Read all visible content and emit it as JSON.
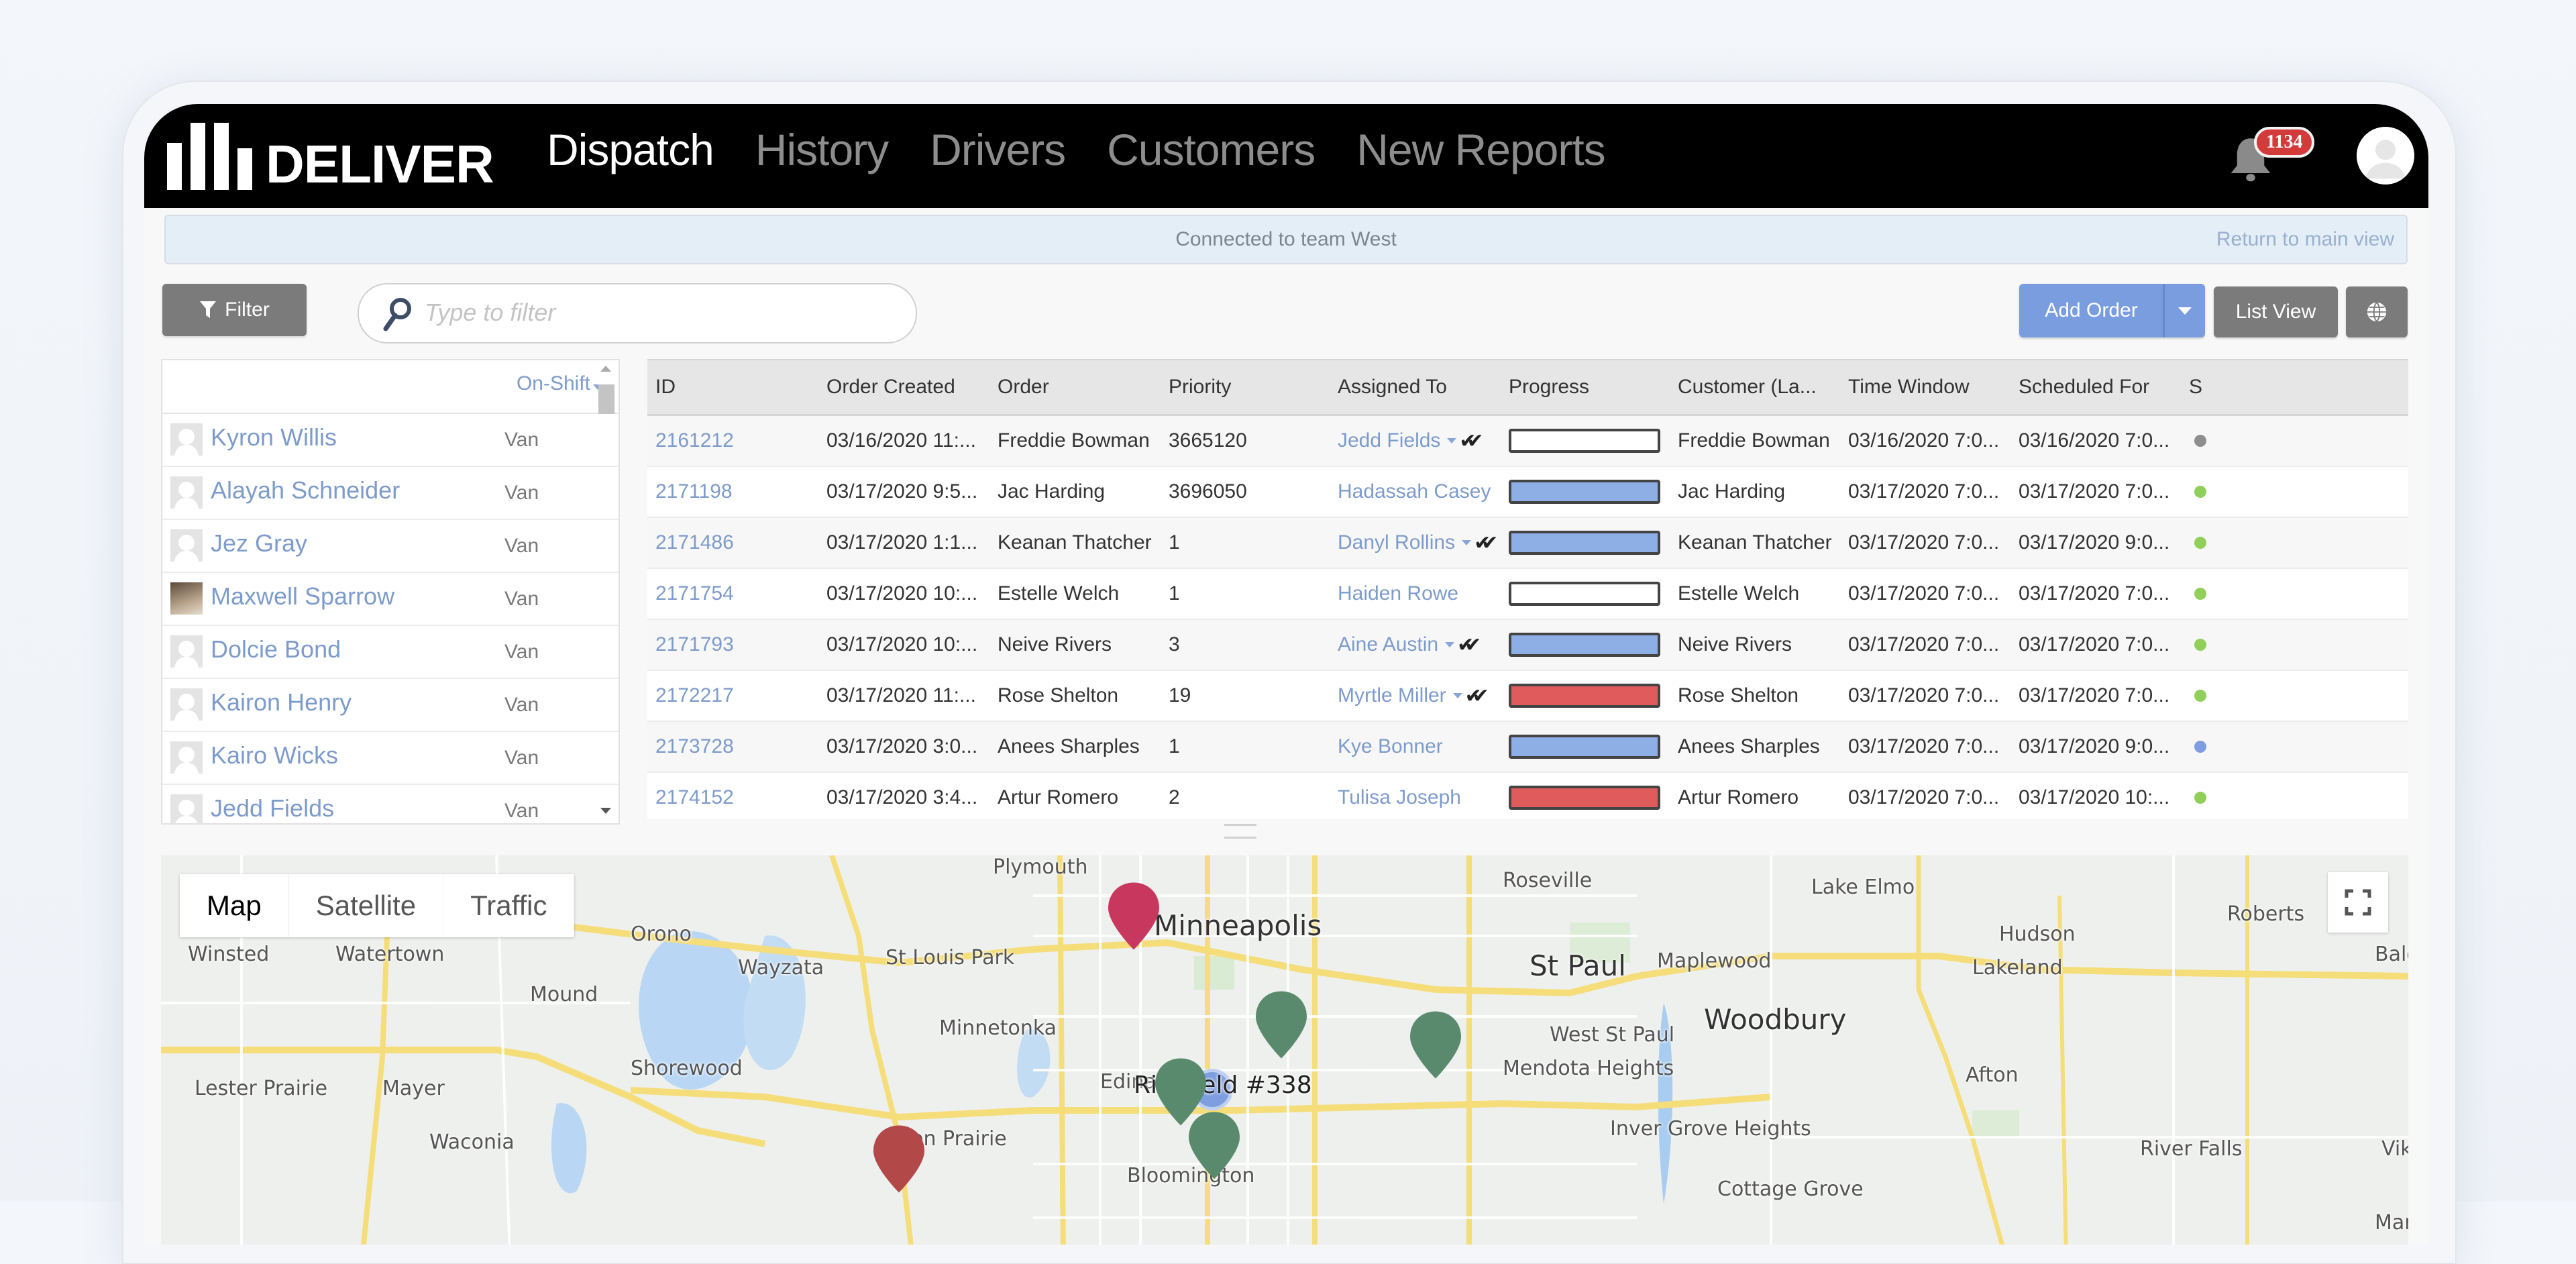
{
  "header": {
    "brand": "DELIVER",
    "nav": [
      {
        "label": "Dispatch",
        "active": true
      },
      {
        "label": "History",
        "active": false
      },
      {
        "label": "Drivers",
        "active": false
      },
      {
        "label": "Customers",
        "active": false
      },
      {
        "label": "New Reports",
        "active": false
      }
    ],
    "notification_count": "1134",
    "icons": {
      "bell": "bell-icon",
      "avatar": "user-avatar-icon"
    }
  },
  "notice": {
    "message": "Connected to team West",
    "return_link": "Return to main view"
  },
  "toolbar": {
    "filter_label": "Filter",
    "search_placeholder": "Type to filter",
    "search_value": "",
    "add_order_label": "Add Order",
    "list_view_label": "List View",
    "icons": {
      "filter": "funnel-icon",
      "search": "search-icon",
      "add_order_menu": "caret-down-icon",
      "map_view": "globe-icon"
    }
  },
  "drivers": {
    "filter_label": "On-Shift",
    "items": [
      {
        "name": "Kyron Willis",
        "vehicle": "Van",
        "has_photo": false
      },
      {
        "name": "Alayah Schneider",
        "vehicle": "Van",
        "has_photo": false
      },
      {
        "name": "Jez Gray",
        "vehicle": "Van",
        "has_photo": false
      },
      {
        "name": "Maxwell Sparrow",
        "vehicle": "Van",
        "has_photo": true
      },
      {
        "name": "Dolcie Bond",
        "vehicle": "Van",
        "has_photo": false
      },
      {
        "name": "Kairon Henry",
        "vehicle": "Van",
        "has_photo": false
      },
      {
        "name": "Kairo Wicks",
        "vehicle": "Van",
        "has_photo": false
      },
      {
        "name": "Jedd Fields",
        "vehicle": "Van",
        "has_photo": false
      }
    ]
  },
  "orders": {
    "columns": [
      "ID",
      "Order Created",
      "Order",
      "Priority",
      "Assigned To",
      "Progress",
      "Customer (La...",
      "Time Window",
      "Scheduled For",
      "S"
    ],
    "rows": [
      {
        "id": "2161212",
        "created": "03/16/2020 11:...",
        "order": "Freddie Bowman",
        "priority": "3665120",
        "assigned": "Jedd Fields",
        "assign_menu": true,
        "confirmed": true,
        "progress": "not-started",
        "progress_color": "#ffffff",
        "customer": "Freddie Bowman",
        "time_window": "03/16/2020 7:0...",
        "scheduled": "03/16/2020 7:0...",
        "status_color": "#8e8e8e"
      },
      {
        "id": "2171198",
        "created": "03/17/2020 9:5...",
        "order": "Jac Harding",
        "priority": "3696050",
        "assigned": "Hadassah Casey",
        "assign_menu": false,
        "confirmed": false,
        "progress": "in-progress",
        "progress_color": "#8eaee6",
        "customer": "Jac Harding",
        "time_window": "03/17/2020 7:0...",
        "scheduled": "03/17/2020 7:0...",
        "status_color": "#8fcf5a"
      },
      {
        "id": "2171486",
        "created": "03/17/2020 1:1...",
        "order": "Keanan Thatcher",
        "priority": "1",
        "assigned": "Danyl Rollins",
        "assign_menu": true,
        "confirmed": true,
        "progress": "in-progress",
        "progress_color": "#8eaee6",
        "customer": "Keanan Thatcher",
        "time_window": "03/17/2020 7:0...",
        "scheduled": "03/17/2020 9:0...",
        "status_color": "#8fcf5a"
      },
      {
        "id": "2171754",
        "created": "03/17/2020 10:...",
        "order": "Estelle Welch",
        "priority": "1",
        "assigned": "Haiden Rowe",
        "assign_menu": false,
        "confirmed": false,
        "progress": "not-started",
        "progress_color": "#ffffff",
        "customer": "Estelle Welch",
        "time_window": "03/17/2020 7:0...",
        "scheduled": "03/17/2020 7:0...",
        "status_color": "#8fcf5a"
      },
      {
        "id": "2171793",
        "created": "03/17/2020 10:...",
        "order": "Neive Rivers",
        "priority": "3",
        "assigned": "Aine Austin",
        "assign_menu": true,
        "confirmed": true,
        "progress": "in-progress",
        "progress_color": "#8eaee6",
        "customer": "Neive Rivers",
        "time_window": "03/17/2020 7:0...",
        "scheduled": "03/17/2020 7:0...",
        "status_color": "#8fcf5a"
      },
      {
        "id": "2172217",
        "created": "03/17/2020 11:...",
        "order": "Rose Shelton",
        "priority": "19",
        "assigned": "Myrtle Miller",
        "assign_menu": true,
        "confirmed": true,
        "progress": "late",
        "progress_color": "#e05c5c",
        "customer": "Rose Shelton",
        "time_window": "03/17/2020 7:0...",
        "scheduled": "03/17/2020 7:0...",
        "status_color": "#8fcf5a"
      },
      {
        "id": "2173728",
        "created": "03/17/2020 3:0...",
        "order": "Anees Sharples",
        "priority": "1",
        "assigned": "Kye Bonner",
        "assign_menu": false,
        "confirmed": false,
        "progress": "in-progress",
        "progress_color": "#8eaee6",
        "customer": "Anees Sharples",
        "time_window": "03/17/2020 7:0...",
        "scheduled": "03/17/2020 9:0...",
        "status_color": "#7f9ee0"
      },
      {
        "id": "2174152",
        "created": "03/17/2020 3:4...",
        "order": "Artur Romero",
        "priority": "2",
        "assigned": "Tulisa Joseph",
        "assign_menu": false,
        "confirmed": false,
        "progress": "late",
        "progress_color": "#e05c5c",
        "customer": "Artur Romero",
        "time_window": "03/17/2020 7:0...",
        "scheduled": "03/17/2020 10:...",
        "status_color": "#8fcf5a"
      }
    ]
  },
  "map": {
    "types": [
      {
        "label": "Map",
        "selected": true
      },
      {
        "label": "Satellite",
        "selected": false
      },
      {
        "label": "Traffic",
        "selected": false
      }
    ],
    "places": [
      "Plymouth",
      "Minneapolis",
      "St Louis Park",
      "Wayzata",
      "Orono",
      "Winsted",
      "Watertown",
      "Mound",
      "Minnetonka",
      "Shorewood",
      "Lester Prairie",
      "Mayer",
      "Waconia",
      "Eden Prairie",
      "Edina",
      "Bloomington",
      "Roseville",
      "St Paul",
      "Maplewood",
      "Woodbury",
      "West St Paul",
      "Mendota Heights",
      "Inver Grove Heights",
      "Cottage Grove",
      "Lake Elmo",
      "Hudson",
      "Lakeland",
      "Afton",
      "Roberts",
      "Baldwin",
      "River Falls",
      "Viking",
      "Martell"
    ],
    "hub_label": "Richfield #338",
    "markers": [
      {
        "color": "#c8385e",
        "place": "Minneapolis"
      },
      {
        "color": "#5a8a6e",
        "place": "South Minneapolis"
      },
      {
        "color": "#5a8a6e",
        "place": "West St Paul"
      },
      {
        "color": "#5a8a6e",
        "place": "Edina"
      },
      {
        "color": "#5a8a6e",
        "place": "Bloomington"
      },
      {
        "color": "#b34848",
        "place": "Eden Prairie"
      }
    ],
    "icons": {
      "fullscreen": "fullscreen-icon"
    }
  }
}
